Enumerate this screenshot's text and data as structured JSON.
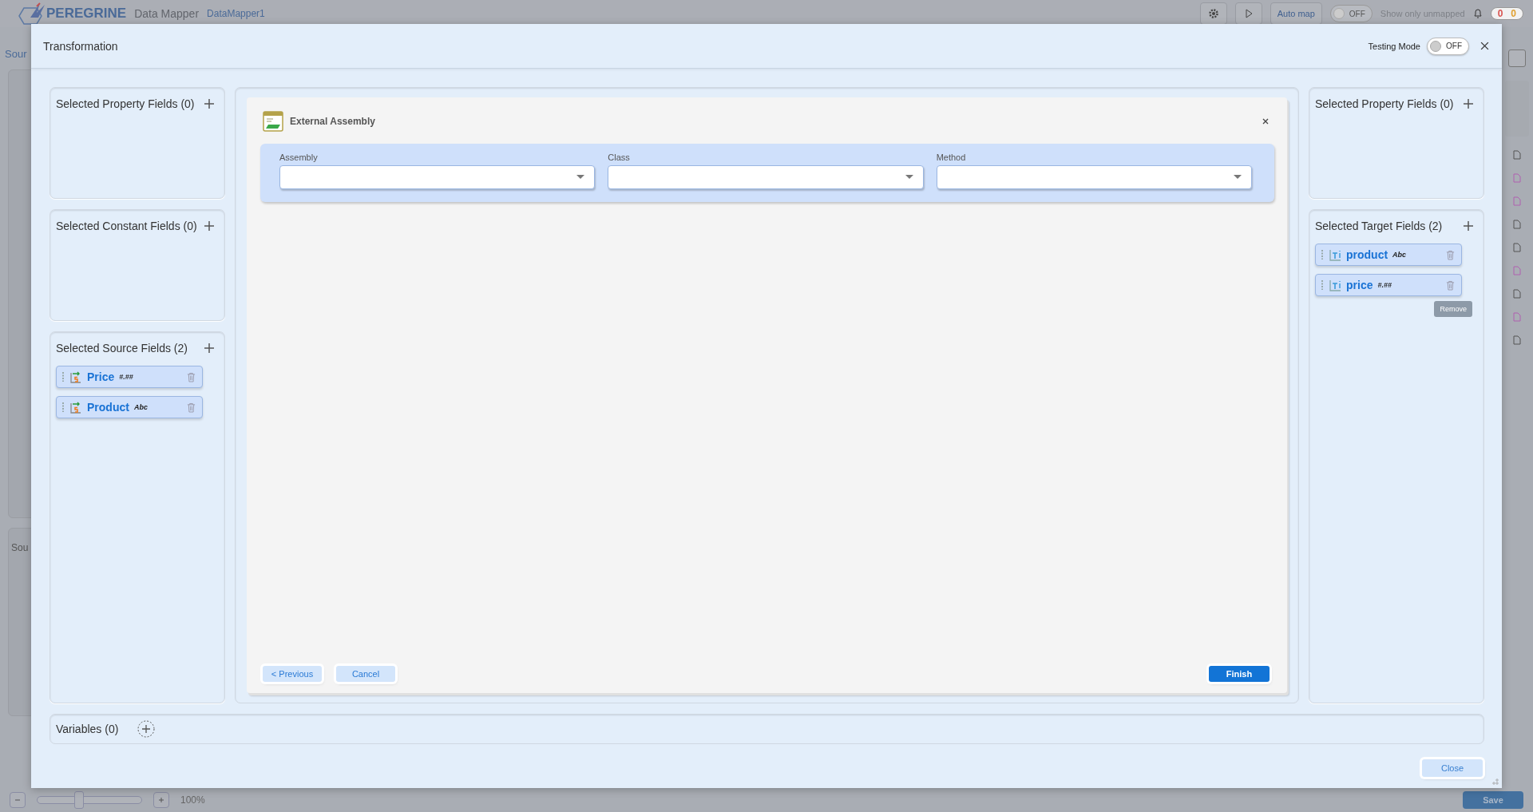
{
  "app": {
    "brand": "PEREGRINE",
    "product": "Data Mapper",
    "document": "DataMapper1",
    "toolbar": {
      "auto_map": "Auto map",
      "unmapped_toggle": {
        "label": "OFF",
        "on": false
      },
      "unmapped_label": "Show only unmapped",
      "counts": [
        {
          "text": "0",
          "color": "#d9534f"
        },
        {
          "text": "0",
          "color": "#e0a030"
        }
      ]
    },
    "left_tab": "Sour",
    "source_panel": "Sou",
    "zoom": {
      "level": 0.4,
      "value": "100%"
    },
    "save": "Save"
  },
  "dialog": {
    "title": "Transformation",
    "testing_mode": {
      "label": "Testing Mode",
      "state": "OFF",
      "on": false
    },
    "left_panels": [
      {
        "title": "Selected Property Fields (0)"
      },
      {
        "title": "Selected Constant Fields (0)"
      },
      {
        "title": "Selected Source Fields (2)",
        "fields": [
          {
            "name": "Price",
            "type": "#.##",
            "kind": "source"
          },
          {
            "name": "Product",
            "type": "Abc",
            "kind": "source"
          }
        ]
      }
    ],
    "wizard": {
      "title": "External Assembly",
      "selects": [
        {
          "label": "Assembly"
        },
        {
          "label": "Class"
        },
        {
          "label": "Method"
        }
      ],
      "buttons": [
        {
          "label": "< Previous",
          "kind": "secondary"
        },
        {
          "label": "Cancel",
          "kind": "secondary"
        },
        {
          "label": "Finish",
          "kind": "primary"
        }
      ]
    },
    "right_panels": [
      {
        "title": "Selected Property Fields (0)"
      },
      {
        "title": "Selected Target Fields (2)",
        "fields": [
          {
            "name": "product",
            "type": "Abc",
            "kind": "target"
          },
          {
            "name": "price",
            "type": "#.##",
            "kind": "target",
            "tooltip": "Remove"
          }
        ]
      }
    ],
    "variables": "Variables (0)",
    "close": "Close"
  }
}
